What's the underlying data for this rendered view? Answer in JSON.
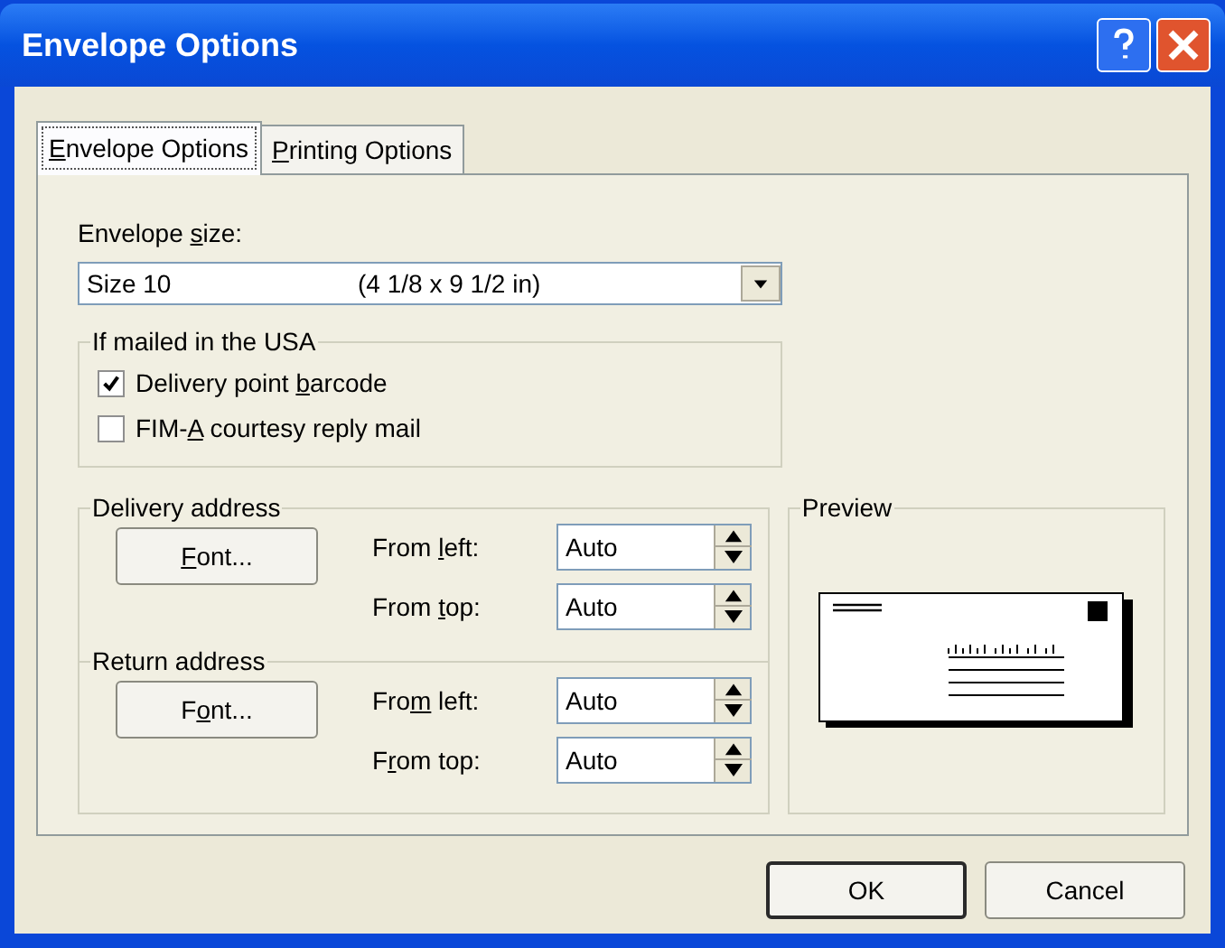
{
  "window": {
    "title": "Envelope Options"
  },
  "tabs": [
    {
      "label": {
        "key": "E",
        "post": "nvelope Options"
      },
      "selected": true
    },
    {
      "label": {
        "key": "P",
        "post": "rinting Options"
      },
      "selected": false
    }
  ],
  "envelope_size": {
    "label": {
      "pre": "Envelope ",
      "key": "s",
      "post": "ize:"
    },
    "value_name": "Size 10",
    "value_dims": "(4 1/8 x 9 1/2 in)"
  },
  "usa_group": {
    "title": "If mailed in the USA",
    "options": [
      {
        "label": {
          "pre": "Delivery point ",
          "key": "b",
          "post": "arcode"
        },
        "checked": true
      },
      {
        "label": {
          "pre": "FIM-",
          "key": "A",
          "post": " courtesy reply mail"
        },
        "checked": false
      }
    ]
  },
  "address_groups": [
    {
      "title": "Delivery address",
      "font_button": {
        "key": "F",
        "post": "ont..."
      },
      "fields": [
        {
          "label": {
            "pre": "From ",
            "key": "l",
            "post": "eft:"
          },
          "value": "Auto"
        },
        {
          "label": {
            "pre": "From ",
            "key": "t",
            "post": "op:"
          },
          "value": "Auto"
        }
      ]
    },
    {
      "title": "Return address",
      "font_button": {
        "pre": "F",
        "key": "o",
        "post": "nt..."
      },
      "fields": [
        {
          "label": {
            "pre": "Fro",
            "key": "m",
            "post": " left:"
          },
          "value": "Auto"
        },
        {
          "label": {
            "pre": "F",
            "key": "r",
            "post": "om top:"
          },
          "value": "Auto"
        }
      ]
    }
  ],
  "preview": {
    "title": "Preview"
  },
  "buttons": [
    {
      "label": "OK",
      "default": true
    },
    {
      "label": "Cancel",
      "default": false
    }
  ]
}
